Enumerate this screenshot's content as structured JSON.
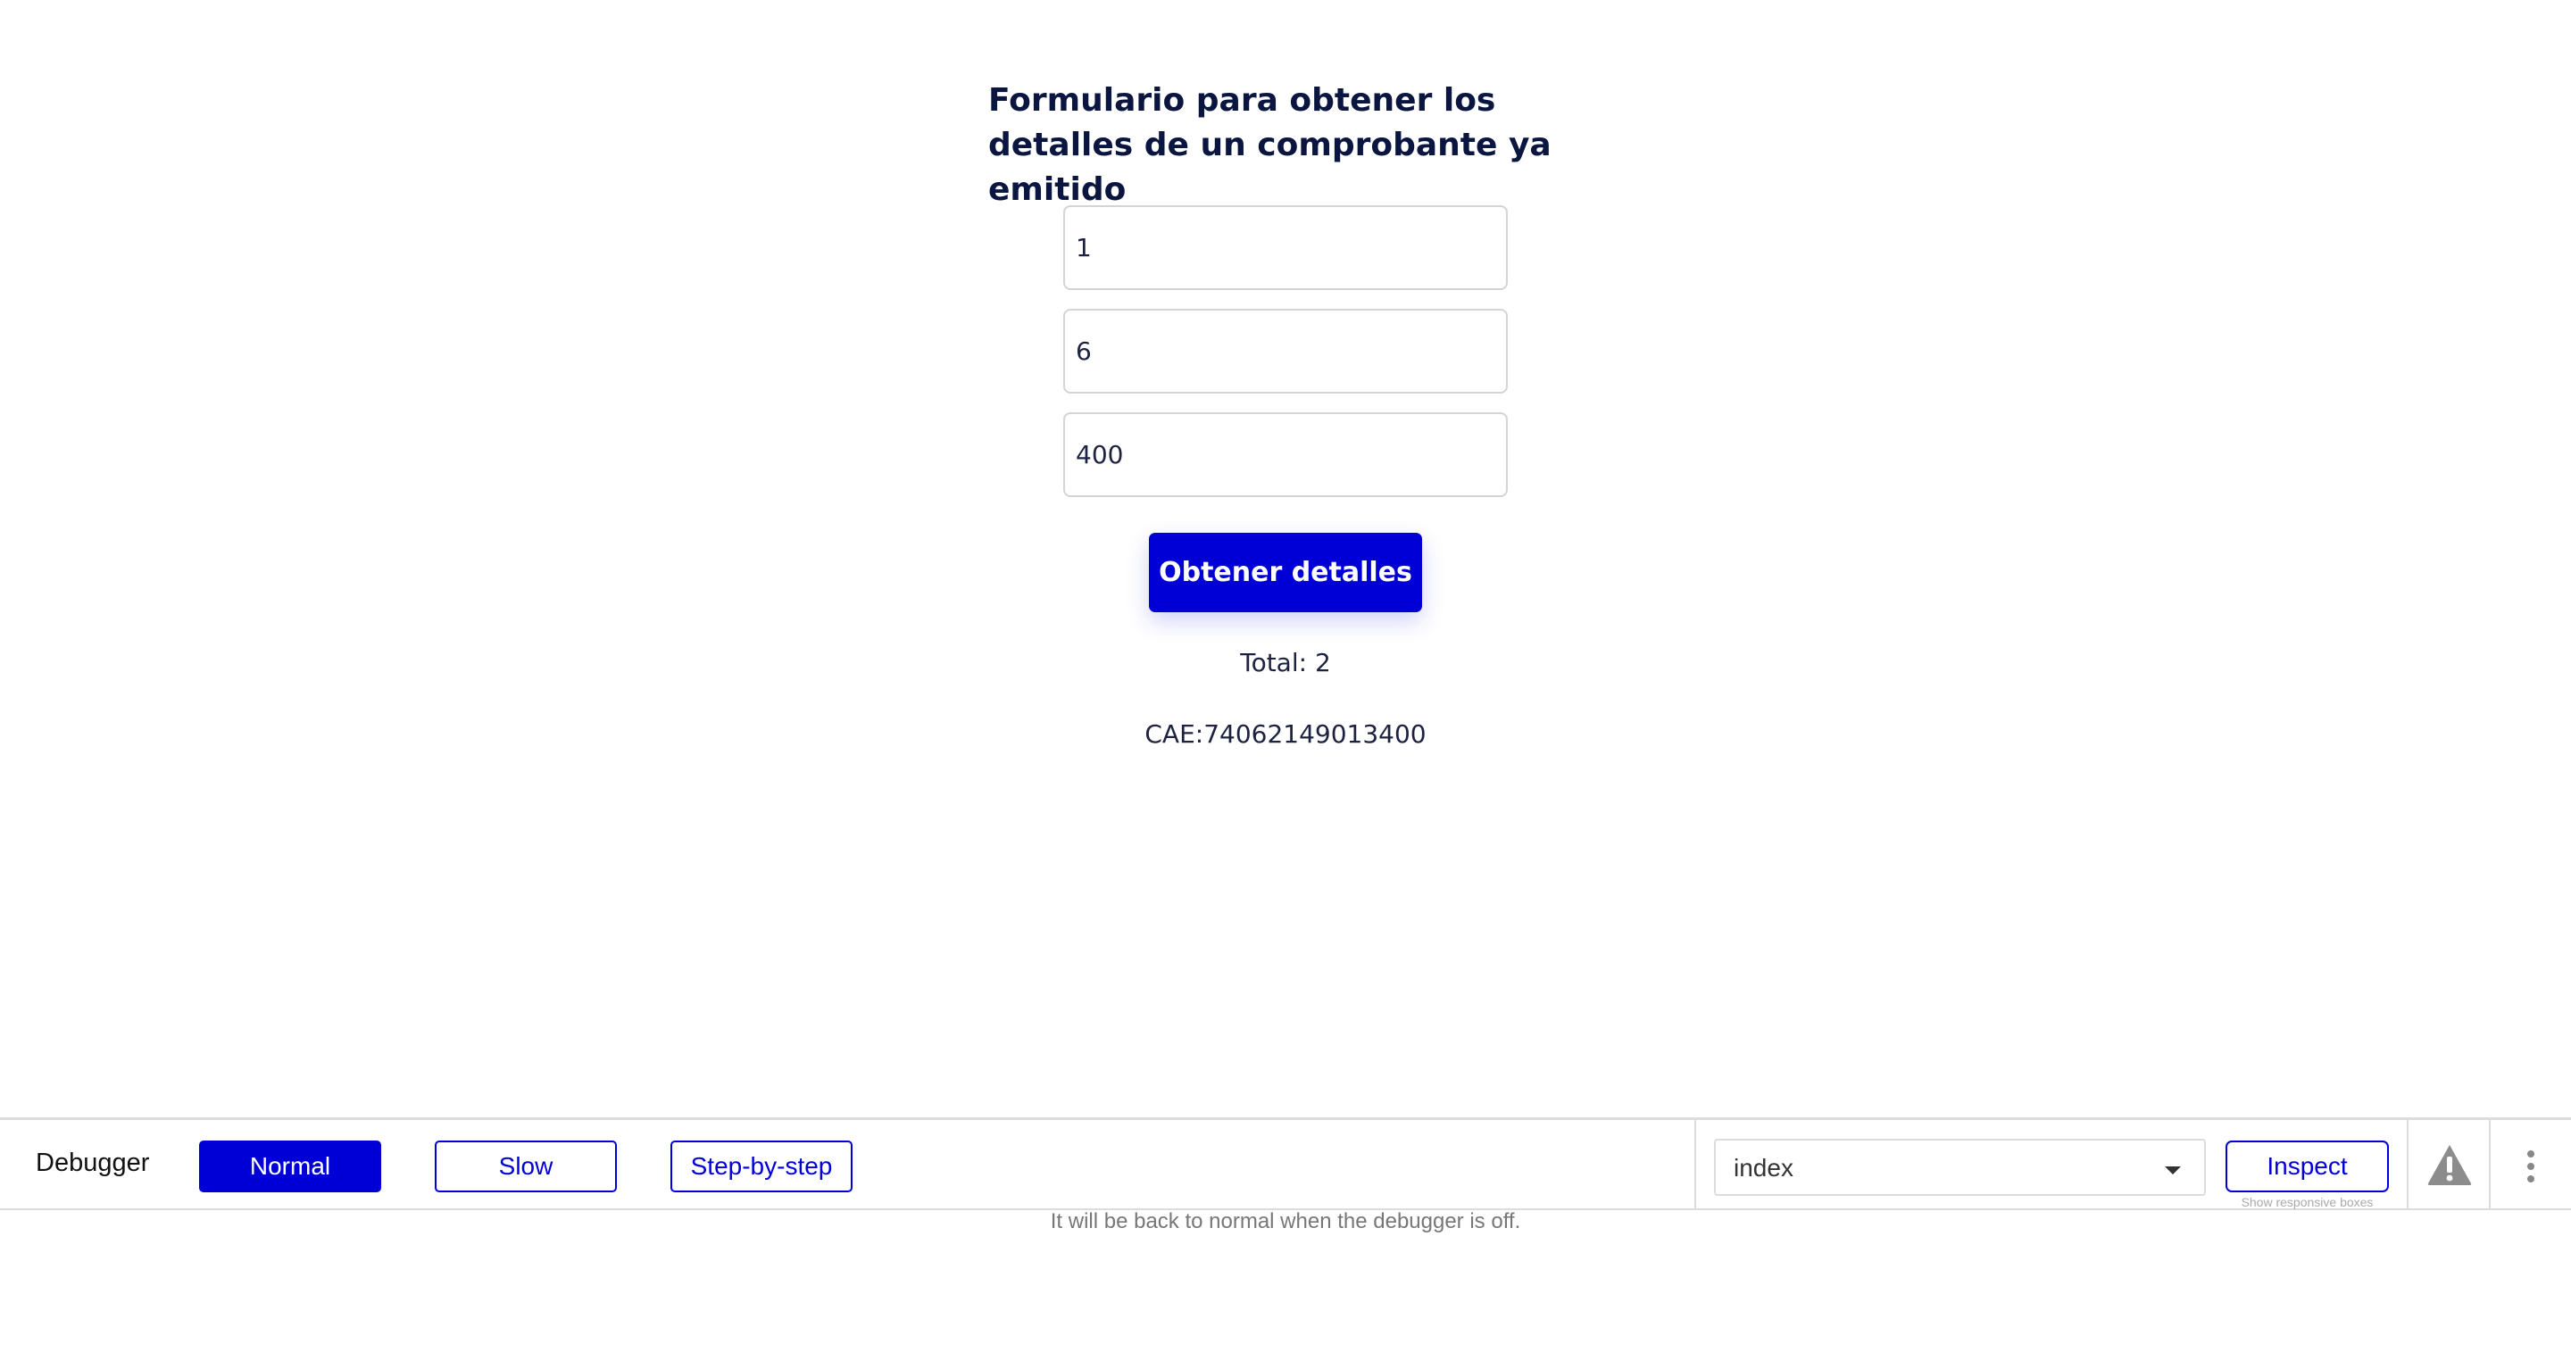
{
  "form": {
    "title": "Formulario para obtener los detalles de un comprobante ya emitido",
    "fields": [
      {
        "value": "1"
      },
      {
        "value": "6"
      },
      {
        "value": "400"
      }
    ],
    "submit_label": "Obtener detalles",
    "total_text": "Total: 2",
    "cae_text": "CAE:74062149013400"
  },
  "debugger": {
    "label": "Debugger",
    "modes": [
      "Normal",
      "Slow",
      "Step-by-step"
    ],
    "active_mode": "Normal",
    "page_select": {
      "value": "index"
    },
    "inspect_label": "Inspect",
    "inspect_hint": "Show responsive boxes",
    "note": "It will be back to normal when the debugger is off.",
    "icons": {
      "warning": "warning-icon",
      "menu": "more-vert-icon"
    }
  },
  "colors": {
    "accent": "#0000d6",
    "title": "#0a1640",
    "border": "#dcdcdc"
  }
}
